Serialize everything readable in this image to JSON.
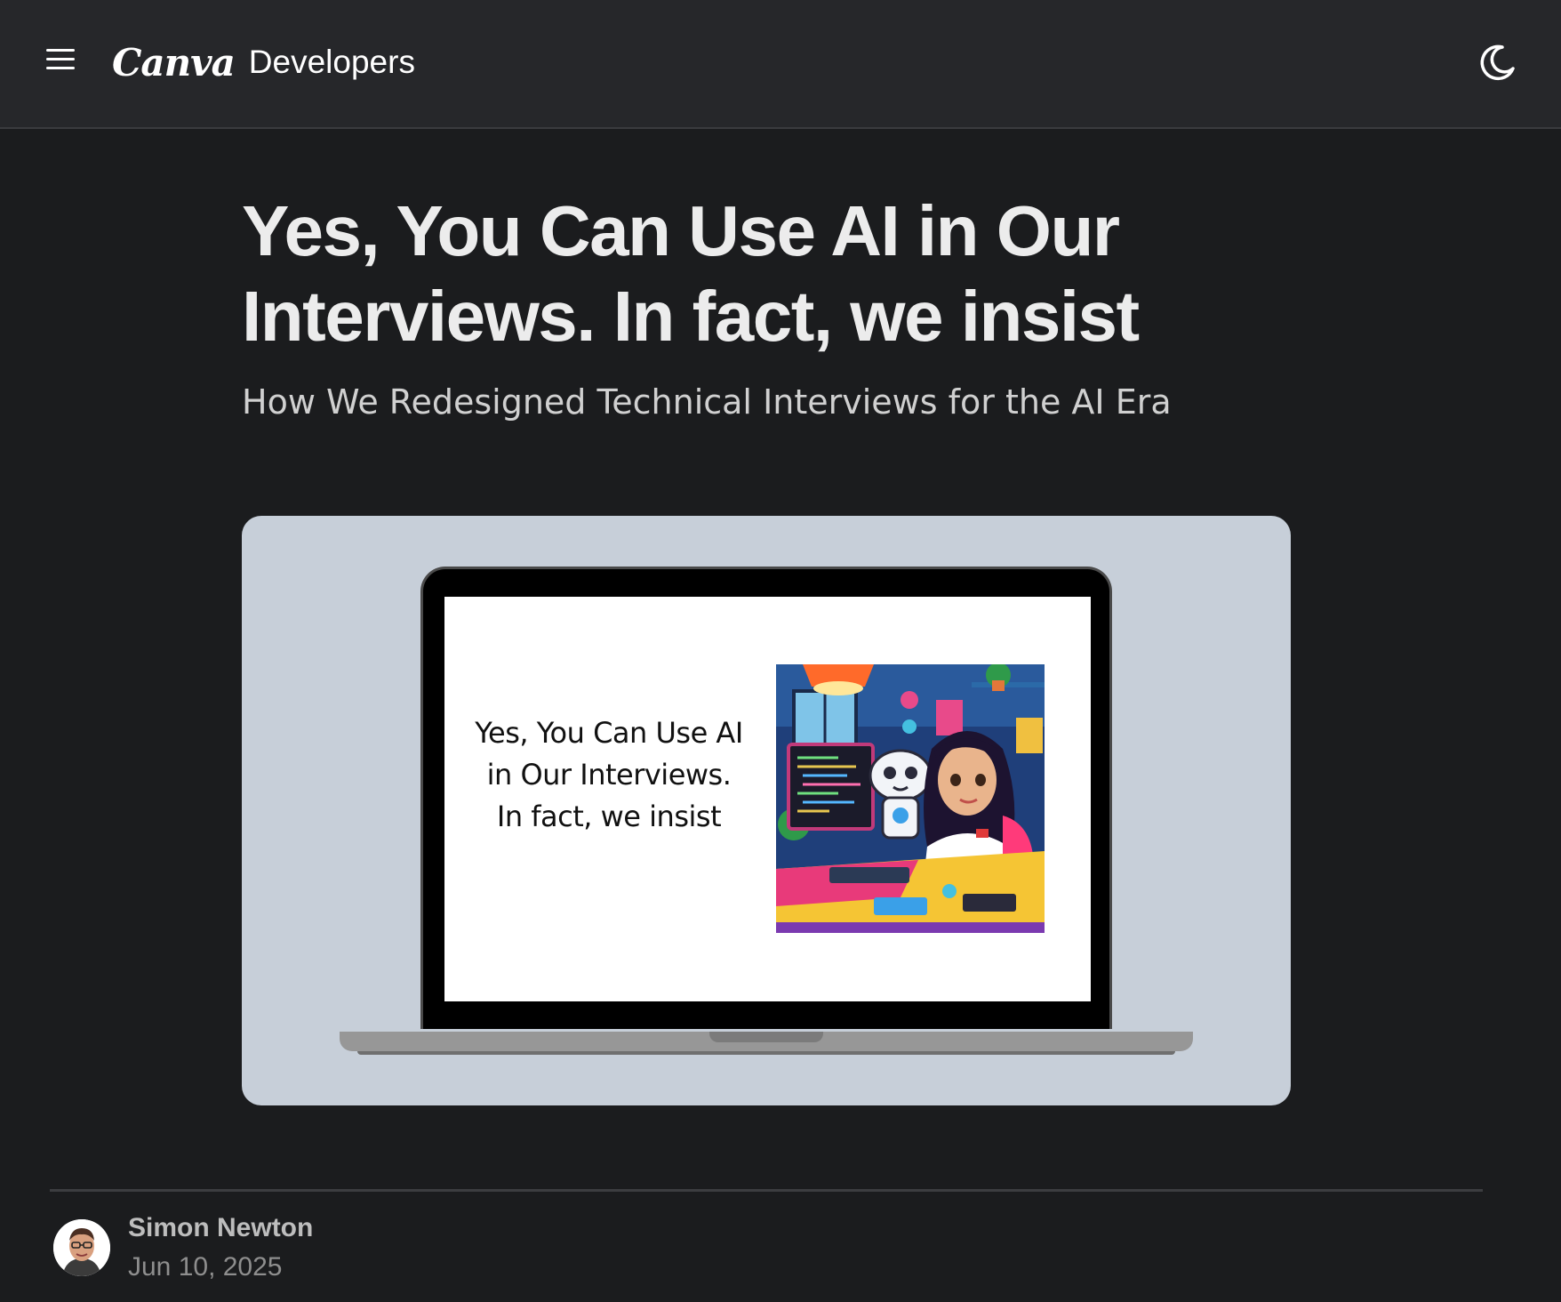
{
  "header": {
    "menu_icon": "hamburger-menu-icon",
    "brand_logo": "Canva",
    "brand_text": "Developers",
    "theme_icon": "moon-icon"
  },
  "article": {
    "title": "Yes, You Can Use AI in Our Interviews. In fact, we insist",
    "subtitle": "How We Redesigned Technical Interviews for the AI Era",
    "hero": {
      "slide_text": "Yes, You Can Use AI in Our Interviews. In fact, we insist",
      "illustration_icon": "woman-and-robot-coding-illustration",
      "background_color": "#c7cfd9"
    }
  },
  "author": {
    "name": "Simon Newton",
    "date": "Jun 10, 2025",
    "avatar_icon": "author-avatar"
  },
  "colors": {
    "page_background": "#1b1c1e",
    "header_background": "#26272a",
    "title_text": "#ececec"
  }
}
